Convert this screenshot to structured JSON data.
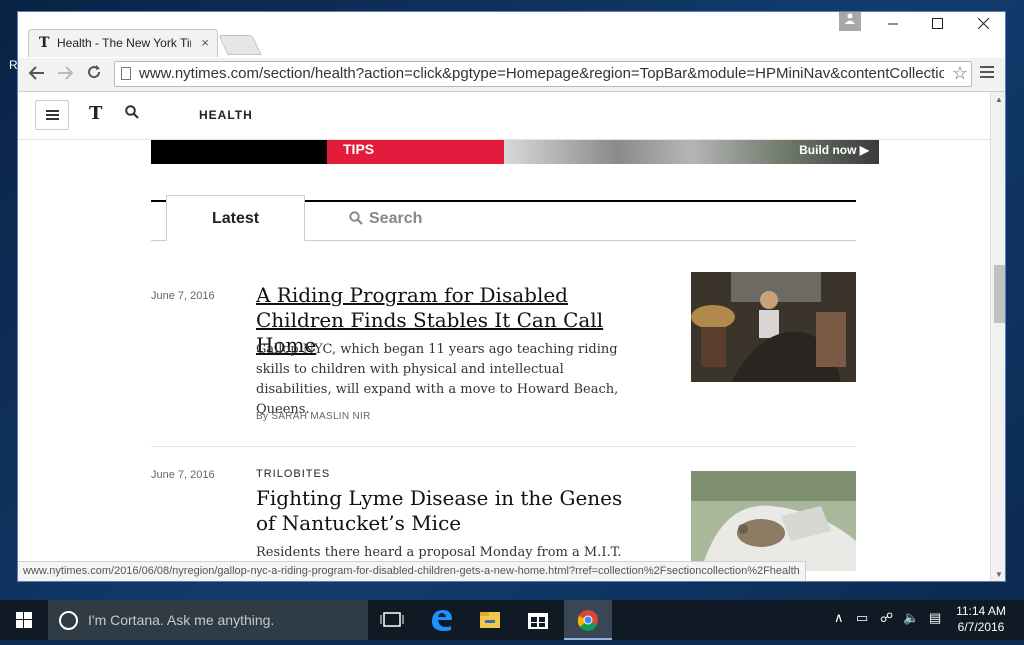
{
  "browser": {
    "tab_title": "Health - The New York Times",
    "tab_close": "×",
    "window_controls": {
      "minimize": "—",
      "maximize": "☐",
      "close": "✕"
    },
    "url": "www.nytimes.com/section/health?action=click&pgtype=Homepage&region=TopBar&module=HPMiniNav&contentCollection=Health",
    "status_url": "www.nytimes.com/2016/06/08/nyregion/gallop-nyc-a-riding-program-for-disabled-children-gets-a-new-home.html?rref=collection%2Fsectioncollection%2Fhealth"
  },
  "desktop_fragment": "R",
  "nyt": {
    "logo_t": "𝕿",
    "section": "HEALTH",
    "ad": {
      "tips": "TIPS",
      "cta": "Build now"
    },
    "tabs": {
      "latest": "Latest",
      "search": "Search"
    }
  },
  "stories": [
    {
      "date": "June 7, 2016",
      "kicker": "",
      "headline": "A Riding Program for Disabled Children Finds Stables It Can Call Home",
      "summary": "Gallop NYC, which began 11 years ago teaching riding skills to children with physical and intellectual disabilities, will expand with a move to Howard Beach, Queens.",
      "byline": "By SARAH MASLIN NIR"
    },
    {
      "date": "June 7, 2016",
      "kicker": "TRILOBITES",
      "headline": "Fighting Lyme Disease in the Genes of Nantucket’s Mice",
      "summary": "Residents there heard a proposal Monday from a M.I.T. scientist to use genetically engineered mice to stop the spread",
      "byline": ""
    }
  ],
  "taskbar": {
    "cortana_placeholder": "I'm Cortana. Ask me anything.",
    "time": "11:14 AM",
    "date": "6/7/2016"
  },
  "colors": {
    "nyt_red": "#e31c3d",
    "taskbar": "#101a24",
    "link_text": "#111111"
  }
}
